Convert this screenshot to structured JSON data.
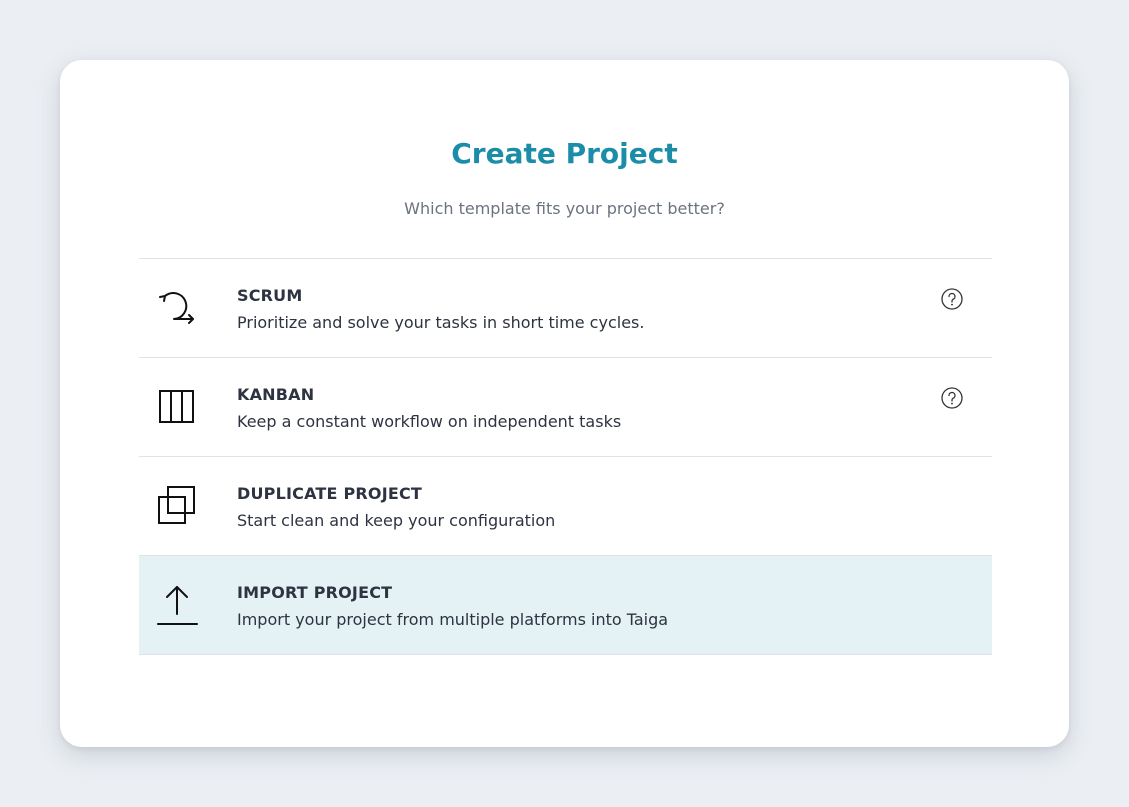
{
  "dialog": {
    "title": "Create Project",
    "subtitle": "Which template fits your project better?"
  },
  "options": [
    {
      "title": "SCRUM",
      "description": "Prioritize and solve your tasks in short time cycles.",
      "icon": "scrum-cycle-icon",
      "has_help": true
    },
    {
      "title": "KANBAN",
      "description": "Keep a constant workflow on independent tasks",
      "icon": "kanban-columns-icon",
      "has_help": true
    },
    {
      "title": "DUPLICATE PROJECT",
      "description": "Start clean and keep your configuration",
      "icon": "duplicate-icon",
      "has_help": false
    },
    {
      "title": "IMPORT PROJECT",
      "description": "Import your project from multiple platforms into Taiga",
      "icon": "upload-icon",
      "has_help": false,
      "highlighted": true
    }
  ],
  "colors": {
    "title": "#1c8da8",
    "highlight_bg": "#e4f1f5",
    "text": "#2d3340",
    "muted": "#6b7380"
  }
}
